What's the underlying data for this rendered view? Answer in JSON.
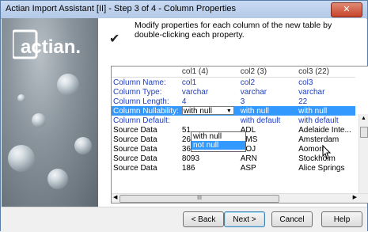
{
  "window": {
    "title": "Actian Import Assistant [II] - Step 3 of 4 - Column Properties",
    "close_glyph": "✕"
  },
  "logo": {
    "text": "actian.",
    "color": "#ffffff"
  },
  "instruction": {
    "text": "Modify properties for each column of the new table by double-clicking each property.",
    "icon": "check-mark-icon",
    "glyph": "✔"
  },
  "grid": {
    "columns": [
      "",
      "col1 (4)",
      "col2 (3)",
      "col3 (22)"
    ],
    "property_rows": [
      {
        "label": "Column Name:",
        "values": [
          "col1",
          "col2",
          "col3"
        ]
      },
      {
        "label": "Column Type:",
        "values": [
          "varchar",
          "varchar",
          "varchar"
        ]
      },
      {
        "label": "Column Length:",
        "values": [
          "4",
          "3",
          "22"
        ]
      },
      {
        "label": "Column Nullability:",
        "values": [
          "with null",
          "with null",
          "with null"
        ]
      },
      {
        "label": "Column Default:",
        "values": [
          "",
          "with default",
          "with default"
        ]
      }
    ],
    "data_rows": [
      {
        "label": "Source Data",
        "values": [
          "51",
          "ADL",
          "Adelaide Inte..."
        ]
      },
      {
        "label": "Source Data",
        "values": [
          "269",
          "AMS",
          "Amsterdam"
        ]
      },
      {
        "label": "Source Data",
        "values": [
          "364",
          "AOJ",
          "Aomori"
        ]
      },
      {
        "label": "Source Data",
        "values": [
          "8093",
          "ARN",
          "Stockholm"
        ]
      },
      {
        "label": "Source Data",
        "values": [
          "186",
          "ASP",
          "Alice Springs"
        ]
      }
    ],
    "dropdown_options": [
      "with null",
      "not null"
    ],
    "dropdown_selected": "not null",
    "hscroll_label": "III"
  },
  "buttons": {
    "back": "< Back",
    "next": "Next >",
    "cancel": "Cancel",
    "help": "Help"
  },
  "colors": {
    "property_label": "#1f3fbf",
    "selection": "#3399ff",
    "titlebar": "#c9daf2",
    "close": "#c7432b"
  }
}
